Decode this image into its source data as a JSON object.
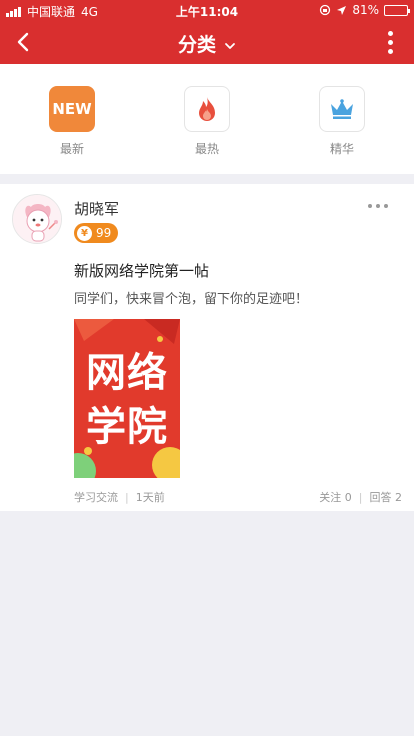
{
  "status_bar": {
    "carrier": "中国联通",
    "network": "4G",
    "time": "上午11:04",
    "battery_percent": "81%",
    "battery_level": 0.81
  },
  "nav": {
    "title": "分类",
    "back_icon": "chevron-left-icon",
    "menu_icon": "vertical-ellipsis-icon"
  },
  "categories": [
    {
      "label": "最新",
      "icon": "new-badge-icon",
      "badge_text": "NEW",
      "color": "#f0883a"
    },
    {
      "label": "最热",
      "icon": "flame-icon",
      "color": "#e84f3d"
    },
    {
      "label": "精华",
      "icon": "crown-icon",
      "color": "#4aa3df"
    }
  ],
  "post": {
    "author": "胡晓军",
    "coins": "99",
    "coin_symbol": "¥",
    "title": "新版网络学院第一帖",
    "content": "同学们，快来冒个泡，留下你的足迹吧！",
    "image_text_line1": "网络",
    "image_text_line2": "学院",
    "category": "学习交流",
    "time_ago": "1天前",
    "follows": "关注 0",
    "answers": "回答 2"
  },
  "colors": {
    "brand_red": "#d92f2f",
    "coin_orange": "#f08a1e",
    "background": "#efeff4"
  }
}
